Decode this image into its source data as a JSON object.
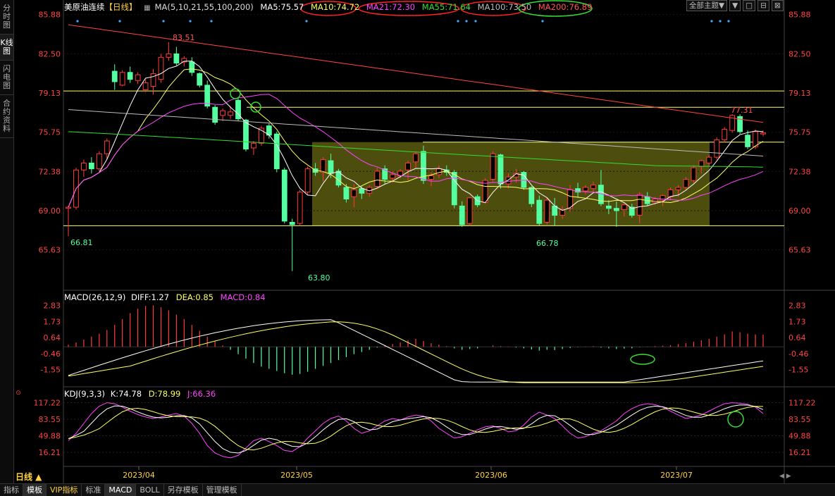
{
  "left_tabs": [
    {
      "label": "分时图"
    },
    {
      "label": "K线图"
    },
    {
      "label": "闪电图"
    },
    {
      "label": "合约资料"
    }
  ],
  "main_panel": {
    "title": "美原油连续",
    "period_tag": "【日线】",
    "ma_def": "MA(5,10,21,55,100,200)",
    "ma5": "MA5:75.57",
    "ma10": "MA10:74.72",
    "ma21": "MA21:72.30",
    "ma55": "MA55:71.64",
    "ma100": "MA100:73.50",
    "ma200": "MA200:76.89"
  },
  "top_right": {
    "theme_label": "全部主题▼",
    "btn1": "▼",
    "btn2": "□",
    "btn3": "⊟",
    "btn4": "⊠"
  },
  "price_axis": {
    "ticks": [
      "85.88",
      "82.50",
      "79.13",
      "75.75",
      "72.38",
      "69.00",
      "65.63"
    ]
  },
  "price_labels": {
    "high1": "83.51",
    "low1": "66.81",
    "low2": "63.80",
    "low3": "66.78",
    "high2": "77.31"
  },
  "macd_panel": {
    "name": "MACD(26,12,9)",
    "diff": "DIFF:1.27",
    "dea": "DEA:0.85",
    "macd": "MACD:0.84",
    "ticks": [
      "2.83",
      "1.73",
      "0.64",
      "-0.46",
      "-1.55"
    ]
  },
  "kdj_panel": {
    "name": "KDJ(9,3,3)",
    "k": "K:74.78",
    "d": "D:78.99",
    "j": "J:66.36",
    "ticks": [
      "117.22",
      "83.55",
      "49.88",
      "16.21"
    ]
  },
  "date_axis": [
    "2023/04",
    "2023/05",
    "2023/06",
    "2023/07"
  ],
  "period_label": "日线 ▲",
  "bottom_tabs": [
    {
      "label": "指标"
    },
    {
      "label": "模板"
    },
    {
      "label": "VIP指标"
    },
    {
      "label": "标准"
    },
    {
      "label": "MACD"
    },
    {
      "label": "BOLL"
    },
    {
      "label": "另存模板"
    },
    {
      "label": "管理模板"
    }
  ],
  "colors": {
    "up": "#ff3b3b",
    "down": "#54ffa0",
    "ma5": "#ffffff",
    "ma10": "#ffff66",
    "ma21": "#ff44ff",
    "ma55": "#33dd33",
    "ma100": "#bbbbbb",
    "ma200": "#ff4444",
    "zone": "#5a5a10",
    "hline": "#ffff66"
  }
}
